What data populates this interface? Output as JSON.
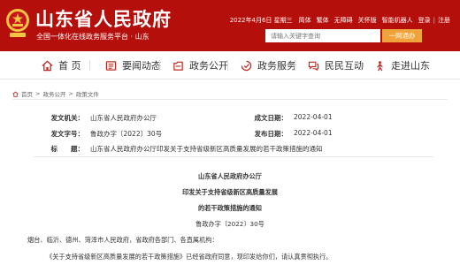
{
  "header": {
    "site_title": "山东省人民政府",
    "site_subtitle": "全国一体化在线政务服务平台 · 山东",
    "date": "2022年4月6日 星期三",
    "links": [
      "简体",
      "繁体",
      "无障碍",
      "关怀版",
      "智能机器人",
      "登录",
      "注册"
    ],
    "search_placeholder": "请输入关键字查询",
    "search_button": "一网通办",
    "brand_color": "#b50f0b"
  },
  "nav": {
    "items": [
      {
        "label": "首 页",
        "icon": "home-icon"
      },
      {
        "label": "要闻动态",
        "icon": "news-icon"
      },
      {
        "label": "政务公开",
        "icon": "affairs-icon"
      },
      {
        "label": "政务服务",
        "icon": "service-icon"
      },
      {
        "label": "民民互动",
        "icon": "interaction-icon"
      },
      {
        "label": "走进山东",
        "icon": "shandong-icon"
      }
    ]
  },
  "breadcrumb": {
    "items": [
      "首页",
      "政务公开",
      "政策文件"
    ],
    "separator": ">"
  },
  "meta": {
    "issuer_label": "发文机关：",
    "issuer": "山东省人民政府办公厅",
    "doc_no_label": "发文字号：",
    "doc_no": "鲁政办字〔2022〕30号",
    "subject_label": "标　　题：",
    "subject": "山东省人民政府办公厅印发关于支持省级新区高质量发展的若干政策措施的通知",
    "created_label": "成文日期：",
    "created": "2022-04-01",
    "published_label": "发布日期：",
    "published": "2022-04-01"
  },
  "document": {
    "org": "山东省人民政府办公厅",
    "title_line1": "印发关于支持省级新区高质量发展",
    "title_line2": "的若干政策措施的通知",
    "number": "鲁政办字〔2022〕30号",
    "recipients": "烟台、临沂、德州、菏泽市人民政府，省政府各部门、各直属机构：",
    "body": "《关于支持省级新区高质量发展的若干政策措施》已经省政府同意，现印发给你们，请认真贯彻执行。"
  }
}
